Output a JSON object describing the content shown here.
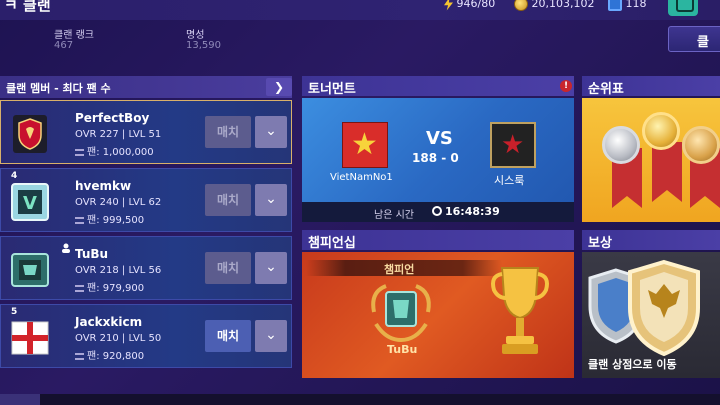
{
  "header": {
    "title": "ㅋ 클랜",
    "energy": "946/80",
    "coins": "20,103,102",
    "gems": "118"
  },
  "stats": {
    "rank_label": "클랜 랭크",
    "rank_value": "467",
    "fame_label": "명성",
    "fame_value": "13,590",
    "clan_button": "클"
  },
  "members_panel": {
    "header": "클랜 멤버 - 최다 팬 수",
    "chevron": "❯",
    "members": [
      {
        "rank": "",
        "name": "PerfectBoy",
        "ovr": "OVR 227 | LVL 51",
        "fans": "팬: 1,000,000",
        "match": "매치",
        "drop": "⌄"
      },
      {
        "rank": "4",
        "name": "hvemkw",
        "ovr": "OVR 240 | LVL 62",
        "fans": "팬: 999,500",
        "match": "매치",
        "drop": "⌄"
      },
      {
        "rank": "",
        "name": "TuBu",
        "ovr": "OVR 218 | LVL 56",
        "fans": "팬: 979,900",
        "match": "매치",
        "drop": "⌄"
      },
      {
        "rank": "5",
        "name": "Jackxkicm",
        "ovr": "OVR 210 | LVL 50",
        "fans": "팬: 920,800",
        "match": "매치",
        "drop": "⌄"
      }
    ]
  },
  "tournament": {
    "title": "토너먼트",
    "alert": "!",
    "vs": "VS",
    "score": "188 - 0",
    "team1": "VietNamNo1",
    "team2": "시스룩",
    "time_label": "남은 시간",
    "time_value": "16:48:39"
  },
  "ranking": {
    "title": "순위표"
  },
  "championship": {
    "title": "챔피언십",
    "label": "챔피언",
    "winner": "TuBu"
  },
  "reward": {
    "title": "보상",
    "text": "클랜 상점으로 이동"
  },
  "colors": {
    "accent": "#4b3fa6",
    "match_active": "#4c5fb3",
    "champion_bg": "#e05a22",
    "tournament_bg": "#2a69c3"
  }
}
